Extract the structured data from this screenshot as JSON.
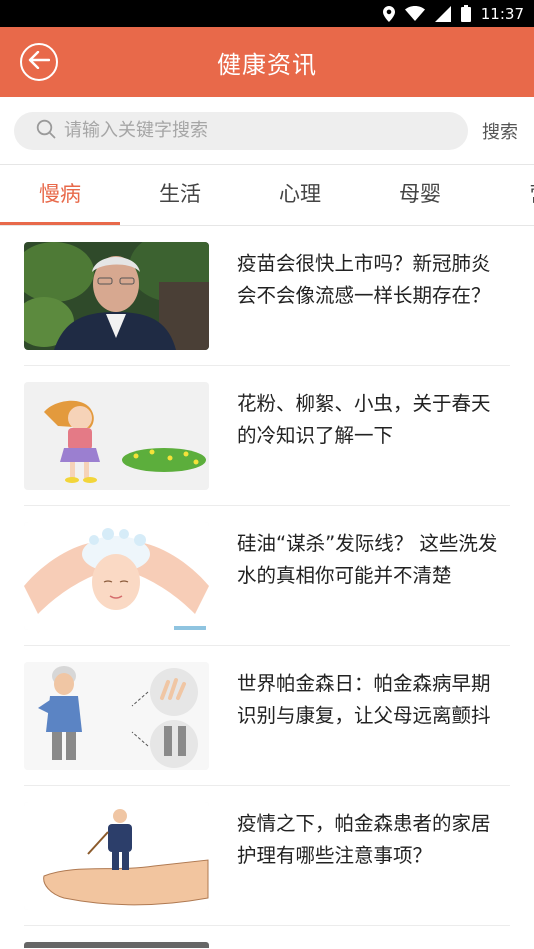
{
  "status_bar": {
    "time": "11:37"
  },
  "header": {
    "title": "健康资讯"
  },
  "search": {
    "placeholder": "请输入关键字搜索",
    "button_label": "搜索"
  },
  "tabs": [
    {
      "label": "慢病",
      "active": true
    },
    {
      "label": "生活",
      "active": false
    },
    {
      "label": "心理",
      "active": false
    },
    {
      "label": "母婴",
      "active": false
    },
    {
      "label": "营",
      "active": false
    }
  ],
  "news": [
    {
      "title": "疫苗会很快上市吗？新冠肺炎会不会像流感一样长期存在？",
      "image": "elderly-man-portrait"
    },
    {
      "title": "花粉、柳絮、小虫，关于春天的冷知识了解一下",
      "image": "girl-sneezing-flowers"
    },
    {
      "title": "硅油“谋杀”发际线？ 这些洗发水的真相你可能并不清楚",
      "image": "woman-washing-hair"
    },
    {
      "title": "世界帕金森日：帕金森病早期识别与康复，让父母远离颤抖",
      "image": "elderly-man-tremor"
    },
    {
      "title": "疫情之下，帕金森患者的家居护理有哪些注意事项？",
      "image": "hand-holding-elderly-man"
    }
  ],
  "colors": {
    "accent": "#e8694a"
  }
}
